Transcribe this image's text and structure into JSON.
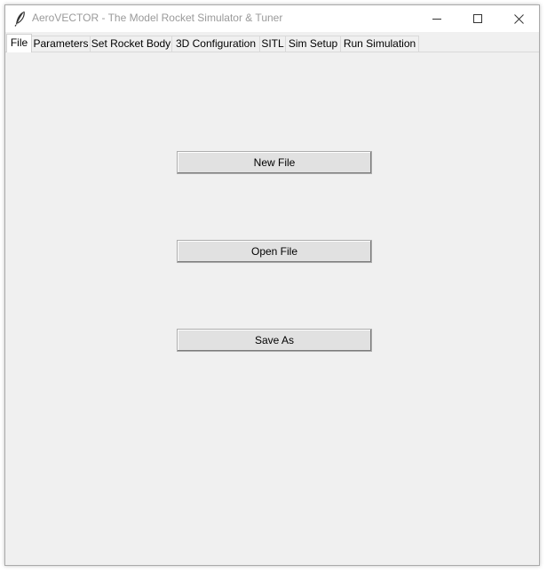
{
  "window": {
    "title": "AeroVECTOR - The Model Rocket Simulator & Tuner",
    "app_icon": "feather-icon",
    "controls": {
      "minimize_icon": "minimize-icon",
      "maximize_icon": "maximize-icon",
      "close_icon": "close-icon"
    }
  },
  "tabs": [
    {
      "label": "File",
      "active": true
    },
    {
      "label": "Parameters",
      "active": false
    },
    {
      "label": "Set Rocket Body",
      "active": false
    },
    {
      "label": "3D Configuration",
      "active": false
    },
    {
      "label": "SITL",
      "active": false
    },
    {
      "label": "Sim Setup",
      "active": false
    },
    {
      "label": "Run Simulation",
      "active": false
    }
  ],
  "file_tab": {
    "new_file_label": "New File",
    "open_file_label": "Open File",
    "save_as_label": "Save As"
  },
  "colors": {
    "window_bg": "#f0f0f0",
    "titlebar_bg": "#ffffff",
    "title_text": "#9a9a9a",
    "button_bg": "#e1e1e1",
    "button_border": "#adadad"
  }
}
